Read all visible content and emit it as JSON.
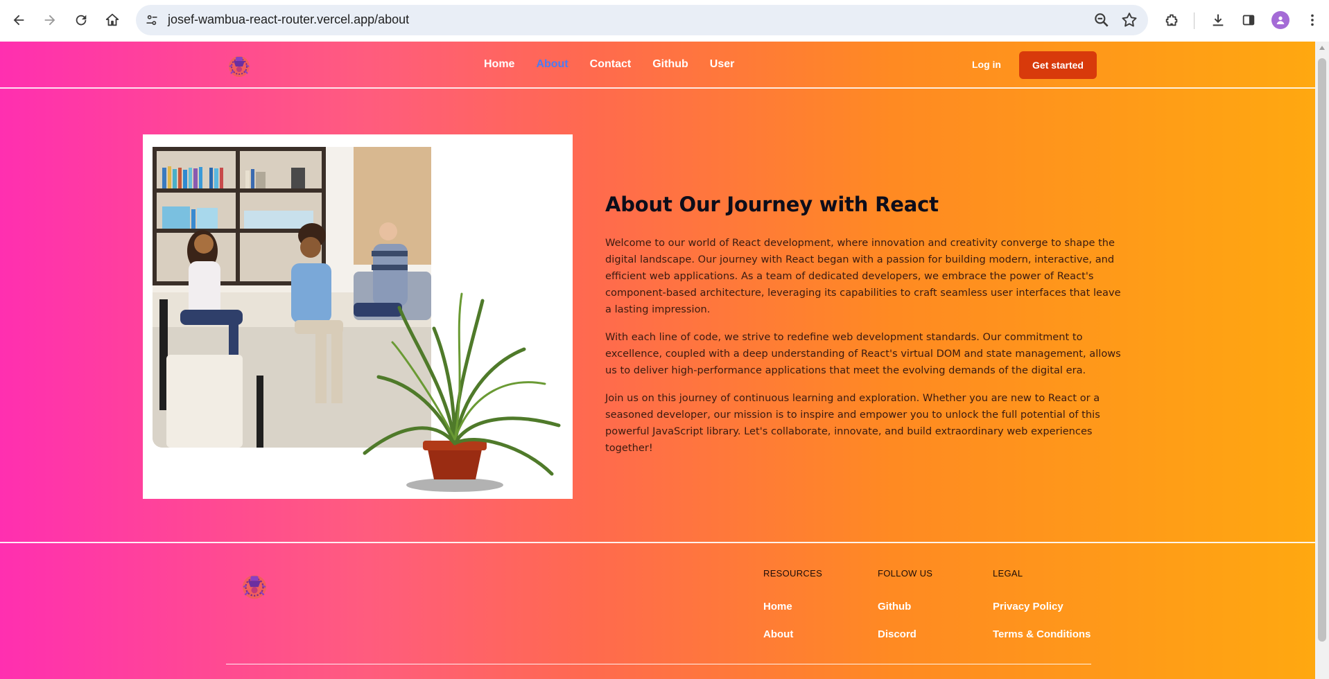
{
  "browser": {
    "url": "josef-wambua-react-router.vercel.app/about",
    "icons": [
      "back-icon",
      "forward-icon",
      "reload-icon",
      "home-icon",
      "site-info-icon",
      "zoom-icon",
      "bookmark-star-icon",
      "extensions-icon",
      "download-icon",
      "side-panel-icon",
      "profile-avatar",
      "menu-kebab-icon"
    ]
  },
  "navbar": {
    "links": [
      {
        "label": "Home",
        "active": false
      },
      {
        "label": "About",
        "active": true
      },
      {
        "label": "Contact",
        "active": false
      },
      {
        "label": "Github",
        "active": false
      },
      {
        "label": "User",
        "active": false
      }
    ],
    "login_label": "Log in",
    "cta_label": "Get started"
  },
  "about": {
    "heading": "About Our Journey with React",
    "paragraphs": [
      "Welcome to our world of React development, where innovation and creativity converge to shape the digital landscape. Our journey with React began with a passion for building modern, interactive, and efficient web applications. As a team of dedicated developers, we embrace the power of React's component-based architecture, leveraging its capabilities to craft seamless user interfaces that leave a lasting impression.",
      "With each line of code, we strive to redefine web development standards. Our commitment to excellence, coupled with a deep understanding of React's virtual DOM and state management, allows us to deliver high-performance applications that meet the evolving demands of the digital era.",
      "Join us on this journey of continuous learning and exploration. Whether you are new to React or a seasoned developer, our mission is to inspire and empower you to unlock the full potential of this powerful JavaScript library. Let's collaborate, innovate, and build extraordinary web experiences together!"
    ]
  },
  "footer": {
    "columns": [
      {
        "heading": "RESOURCES",
        "links": [
          "Home",
          "About"
        ]
      },
      {
        "heading": "FOLLOW US",
        "links": [
          "Github",
          "Discord"
        ]
      },
      {
        "heading": "LEGAL",
        "links": [
          "Privacy Policy",
          "Terms & Conditions"
        ]
      }
    ]
  },
  "colors": {
    "gradient_start": "#ff2fb0",
    "gradient_end": "#ffa810",
    "active_link": "#4a7cf5",
    "cta_bg": "#d83a0b"
  }
}
